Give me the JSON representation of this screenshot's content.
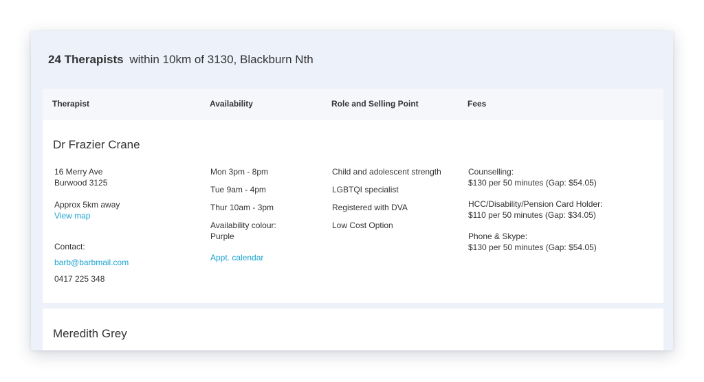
{
  "results": {
    "count": "24 Therapists",
    "location": "within 10km of 3130, Blackburn Nth"
  },
  "table_headers": {
    "therapist": "Therapist",
    "availability": "Availability",
    "role": "Role and Selling Point",
    "fees": "Fees"
  },
  "therapists": [
    {
      "name": "Dr Frazier Crane",
      "address_line1": "16 Merry Ave",
      "address_line2": "Burwood 3125",
      "distance": "Approx 5km away",
      "map_link": "View map",
      "contact_label": "Contact:",
      "email": "barb@barbmail.com",
      "phone": "0417 225 348",
      "availability": [
        "Mon 3pm - 8pm",
        "Tue 9am - 4pm",
        "Thur 10am - 3pm"
      ],
      "availability_colour_label": "Availability colour:",
      "availability_colour": "Purple",
      "calendar_link": "Appt. calendar",
      "roles": [
        "Child and adolescent strength",
        "LGBTQI specialist",
        "Registered with DVA",
        "Low Cost Option"
      ],
      "fees": [
        {
          "label": "Counselling:",
          "amount": "$130 per 50 minutes (Gap: $54.05)"
        },
        {
          "label": "HCC/Disability/Pension Card Holder:",
          "amount": "$110 per 50 minutes (Gap: $34.05)"
        },
        {
          "label": "Phone & Skype:",
          "amount": "$130 per 50 minutes (Gap: $54.05)"
        }
      ]
    },
    {
      "name": "Meredith Grey"
    }
  ],
  "colors": {
    "link": "#1aa3d0",
    "panel_bg": "#edf1fa",
    "header_bg": "#f6f7fb"
  }
}
